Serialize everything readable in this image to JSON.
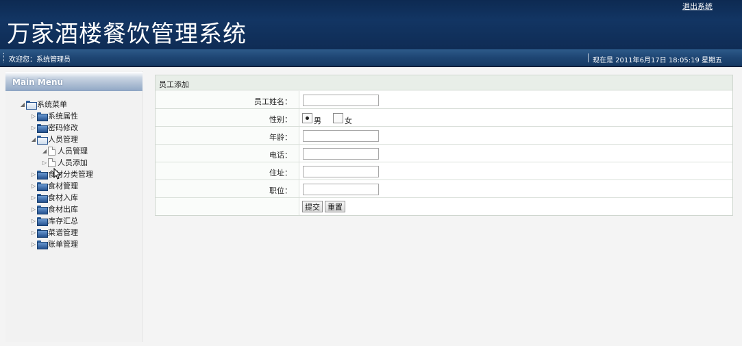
{
  "header": {
    "title": "万家酒楼餐饮管理系统",
    "logout": "退出系统"
  },
  "infobar": {
    "welcome": "欢迎您：系统管理员",
    "datetime": "现在是 2011年6月17日  18:05:19 星期五"
  },
  "menu": {
    "title": "Main Menu",
    "items": [
      {
        "label": "系统菜单",
        "type": "folder-open",
        "expanded": true
      },
      {
        "label": "系统属性",
        "type": "folder"
      },
      {
        "label": "密码修改",
        "type": "folder"
      },
      {
        "label": "人员管理",
        "type": "folder-open",
        "expanded": true
      },
      {
        "label": "人员管理",
        "type": "doc",
        "expanded": true
      },
      {
        "label": "人员添加",
        "type": "doc"
      },
      {
        "label": "食材分类管理",
        "type": "folder"
      },
      {
        "label": "食材管理",
        "type": "folder"
      },
      {
        "label": "食材入库",
        "type": "folder"
      },
      {
        "label": "食材出库",
        "type": "folder"
      },
      {
        "label": "库存汇总",
        "type": "folder"
      },
      {
        "label": "菜谱管理",
        "type": "folder"
      },
      {
        "label": "账单管理",
        "type": "folder"
      }
    ]
  },
  "form": {
    "caption": "员工添加",
    "fields": {
      "name": {
        "label": "员工姓名：",
        "value": ""
      },
      "gender": {
        "label": "性别：",
        "options": [
          "男",
          "女"
        ],
        "selected": "男"
      },
      "age": {
        "label": "年龄：",
        "value": ""
      },
      "phone": {
        "label": "电话：",
        "value": ""
      },
      "address": {
        "label": "住址：",
        "value": ""
      },
      "position": {
        "label": "职位：",
        "value": ""
      }
    },
    "submit_label": "提交",
    "reset_label": "重置"
  }
}
